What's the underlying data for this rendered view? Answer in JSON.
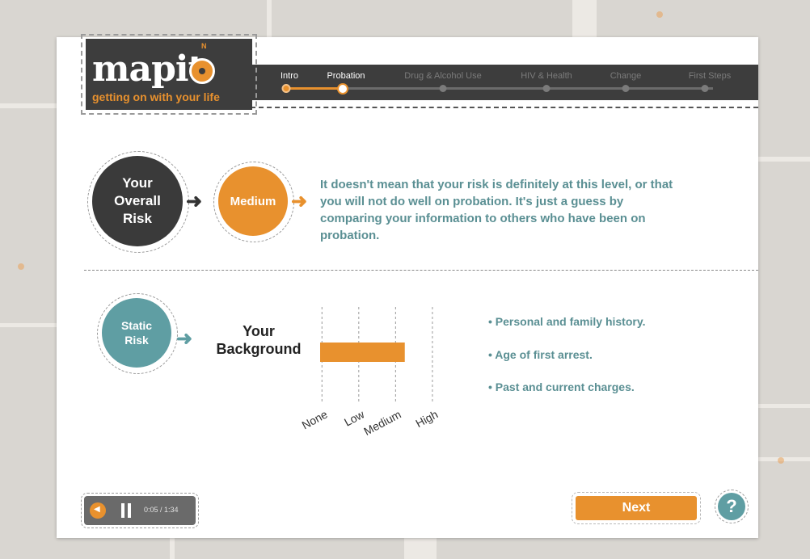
{
  "logo": {
    "wordmark": "mapit",
    "compass_letter": "N",
    "tagline": "getting on with your life"
  },
  "nav": {
    "steps": [
      {
        "label": "Intro",
        "state": "done"
      },
      {
        "label": "Probation",
        "state": "current"
      },
      {
        "label": "Drug & Alcohol Use",
        "state": "upcoming"
      },
      {
        "label": "HIV & Health",
        "state": "upcoming"
      },
      {
        "label": "Change",
        "state": "upcoming"
      },
      {
        "label": "First Steps",
        "state": "upcoming"
      }
    ]
  },
  "overall": {
    "label_line1": "Your",
    "label_line2": "Overall",
    "label_line3": "Risk",
    "level": "Medium",
    "description": "It doesn't mean that your risk is definitely at this level, or that you will not do well on probation. It's just a guess by comparing your information to others who have been on probation."
  },
  "static": {
    "label_line1": "Static",
    "label_line2": "Risk",
    "background_line1": "Your",
    "background_line2": "Background",
    "bullets": [
      "• Personal and family history.",
      "• Age of first arrest.",
      "• Past and current charges."
    ]
  },
  "chart_data": {
    "type": "bar",
    "orientation": "horizontal",
    "categories": [
      "None",
      "Low",
      "Medium",
      "High"
    ],
    "value": 2.3,
    "xlim": [
      0,
      3.25
    ]
  },
  "player": {
    "time": "0:05 / 1:34"
  },
  "footer": {
    "next_label": "Next",
    "help_label": "?"
  },
  "colors": {
    "accent": "#e8912e",
    "teal": "#5f9ea3",
    "dark": "#3d3d3d"
  }
}
